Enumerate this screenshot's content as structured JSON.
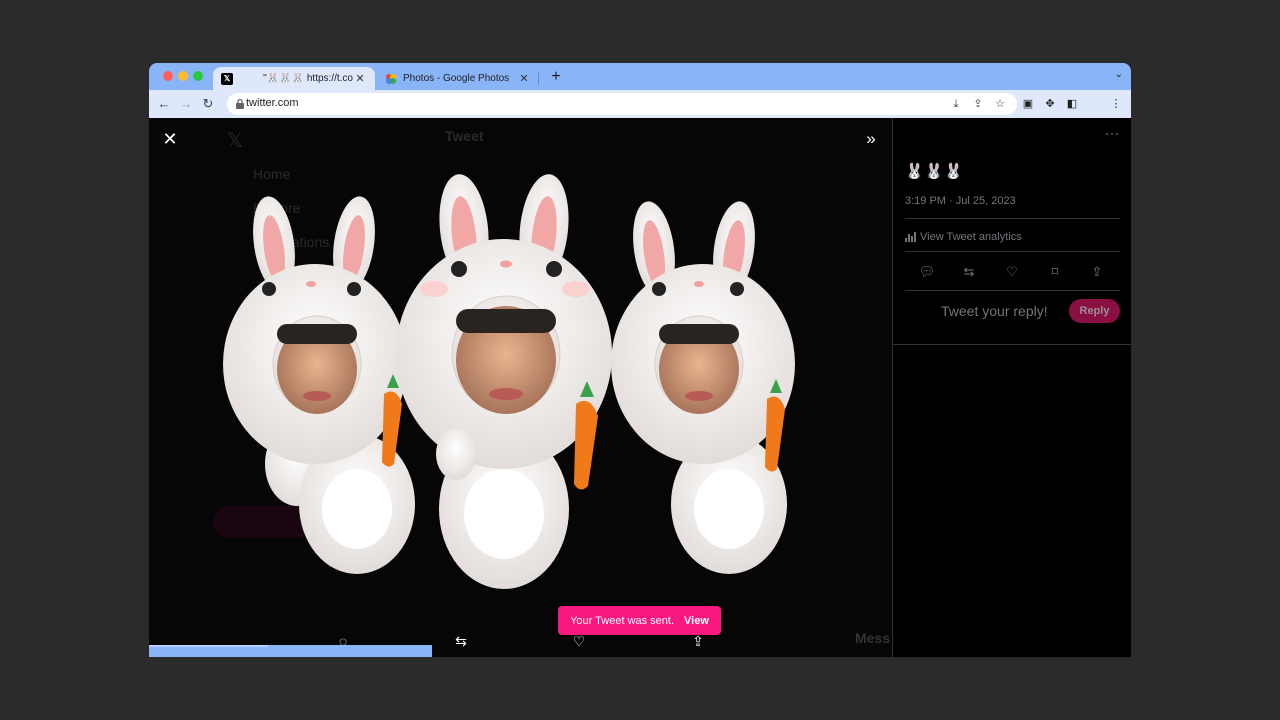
{
  "browser": {
    "tabs": [
      {
        "title": "\"🐰🐰🐰 https://t.co",
        "favicon": "x-logo-icon",
        "active": true
      },
      {
        "title": "Photos - Google Photos",
        "favicon": "google-photos-icon",
        "active": false
      }
    ],
    "url": "twitter.com"
  },
  "media_viewer": {
    "toast_text": "Your Tweet was sent.",
    "toast_action": "View"
  },
  "tweet": {
    "text": "🐰🐰🐰",
    "timestamp": "3:19 PM · Jul 25, 2023",
    "analytics_label": "View Tweet analytics",
    "reply_placeholder": "Tweet your reply!",
    "reply_button": "Reply"
  },
  "background_ghost": {
    "header": "Tweet",
    "nav": [
      "Home",
      "Explore",
      "Notifications"
    ],
    "messages": "Mess"
  },
  "colors": {
    "accent": "#f91880",
    "chrome_tab_strip": "#8ab4f8",
    "reply_button_disabled": "#8a1042"
  }
}
